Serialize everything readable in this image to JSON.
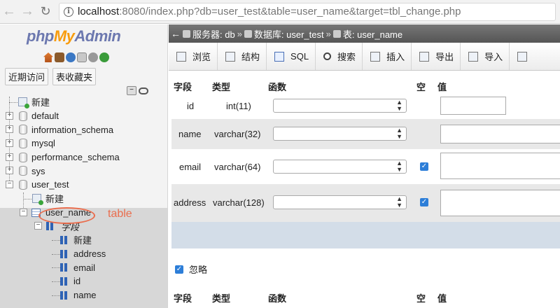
{
  "browser": {
    "url_host": "localhost",
    "url_rest": ":8080/index.php?db=user_test&table=user_name&target=tbl_change.php"
  },
  "sidebar": {
    "logo_php": "php",
    "logo_my": "My",
    "logo_admin": "Admin",
    "tabs": [
      "近期访问",
      "表收藏夹"
    ],
    "tree": {
      "new": "新建",
      "databases": [
        "default",
        "information_schema",
        "mysql",
        "performance_schema",
        "sys",
        "user_test"
      ],
      "user_test_new": "新建",
      "table": "user_name",
      "columns_group": "字段",
      "columns_new": "新建",
      "columns": [
        "address",
        "email",
        "id",
        "name"
      ]
    },
    "annotation": "table"
  },
  "breadcrumb": {
    "server": "服务器: db",
    "database": "数据库: user_test",
    "table": "表: user_name"
  },
  "menu": [
    "浏览",
    "结构",
    "SQL",
    "搜索",
    "插入",
    "导出",
    "导入"
  ],
  "grid": {
    "headers": {
      "field": "字段",
      "type": "类型",
      "function": "函数",
      "null": "空",
      "value": "值"
    },
    "rows": [
      {
        "field": "id",
        "type": "int(11)",
        "null_checked": false
      },
      {
        "field": "name",
        "type": "varchar(32)",
        "null_checked": false
      },
      {
        "field": "email",
        "type": "varchar(64)",
        "null_checked": true
      },
      {
        "field": "address",
        "type": "varchar(128)",
        "null_checked": true
      }
    ],
    "ignore_label": "忽略"
  }
}
